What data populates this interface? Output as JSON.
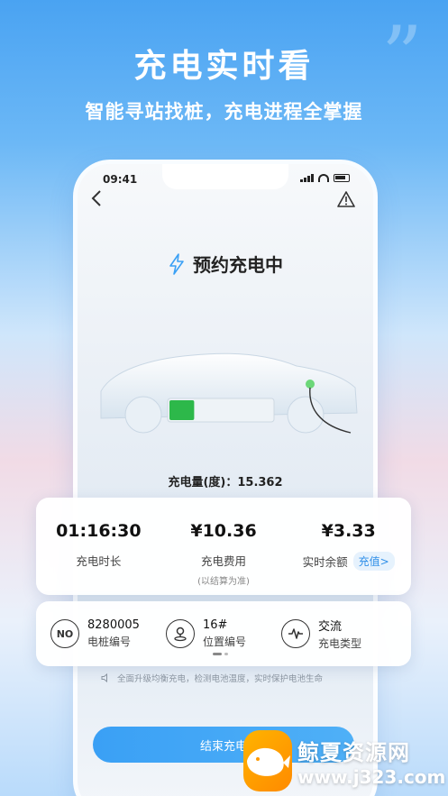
{
  "banner": {
    "headline": "充电实时看",
    "subline": "智能寻站找桩，充电进程全掌握"
  },
  "status_bar": {
    "time": "09:41"
  },
  "charging": {
    "title": "预约充电中",
    "charge_amount": "充电量(度)：15.362",
    "battery_level": 0.12
  },
  "stats": [
    {
      "value": "01:16:30",
      "label": "充电时长",
      "note": ""
    },
    {
      "value": "¥10.36",
      "label": "充电费用",
      "note": "(以结算为准)"
    },
    {
      "value": "¥3.33",
      "label": "实时余额",
      "note": ""
    }
  ],
  "recharge_label": "充值>",
  "info": [
    {
      "icon": "no-badge-icon",
      "icon_text": "NO",
      "value": "8280005",
      "label": "电桩编号"
    },
    {
      "icon": "location-pin-icon",
      "value": "16#",
      "label": "位置编号"
    },
    {
      "icon": "waveform-icon",
      "value": "交流",
      "label": "充电类型"
    }
  ],
  "tip": "全面升级均衡充电，检测电池温度，实时保护电池生命",
  "end_button": "结束充电",
  "watermark": {
    "name": "鲸夏资源网",
    "url": "www.j323.com"
  },
  "colors": {
    "accent": "#3aa0f5",
    "battery_green": "#2db84a"
  }
}
